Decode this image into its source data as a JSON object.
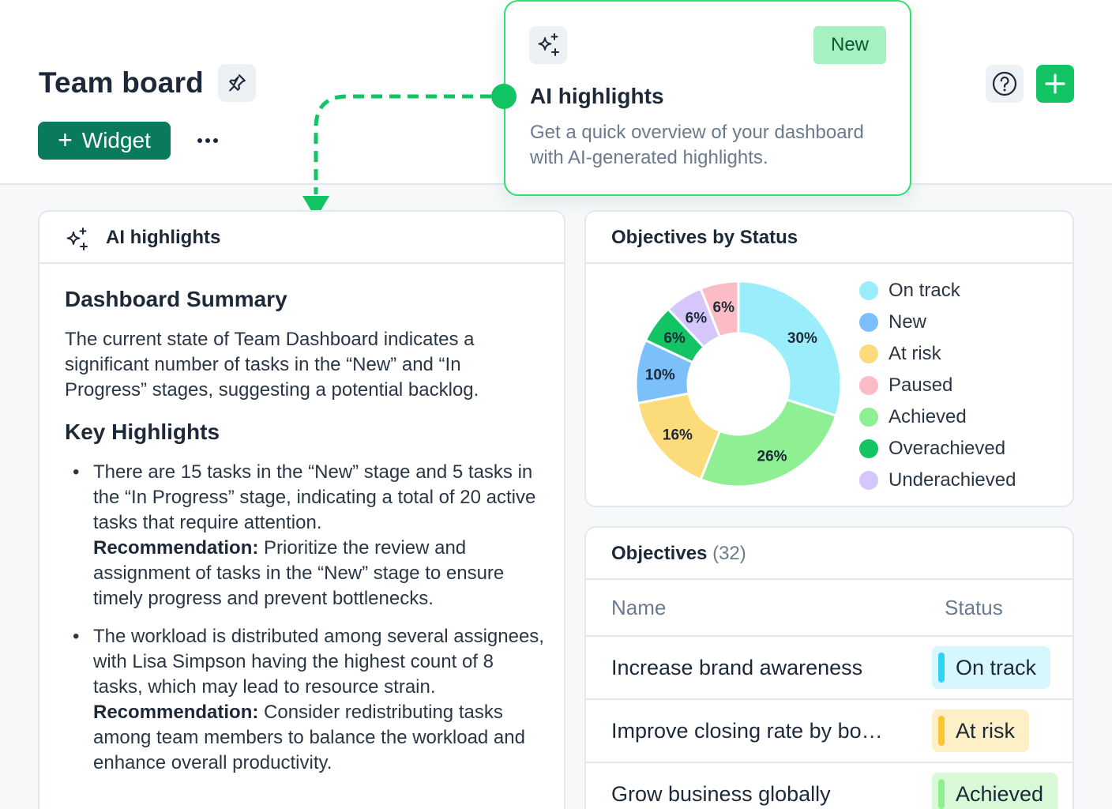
{
  "header": {
    "title": "Team board",
    "widget_label": "Widget"
  },
  "popover": {
    "badge": "New",
    "title": "AI highlights",
    "description": "Get a quick overview of your dashboard with AI-generated highlights."
  },
  "ai_card": {
    "title": "AI highlights",
    "summary_heading": "Dashboard Summary",
    "summary_text": "The current state of Team Dashboard indicates a significant number of tasks in the “New” and “In Progress” stages, suggesting a potential backlog.",
    "key_heading": "Key Highlights",
    "bullets": [
      {
        "text": "There are 15 tasks in the “New” stage and 5 tasks in the “In Progress” stage, indicating a total of 20 active tasks that require attention.",
        "rec_label": "Recommendation:",
        "rec_text": "Prioritize the review and assignment of tasks in the “New” stage to ensure timely progress and prevent bottlenecks."
      },
      {
        "text": "The workload is distributed among several assignees, with Lisa Simpson having the highest count of 8 tasks, which may lead to resource strain.",
        "rec_label": "Recommendation:",
        "rec_text": "Consider redistributing tasks among team members to balance the workload and enhance overall productivity."
      }
    ]
  },
  "status_card": {
    "title": "Objectives by Status"
  },
  "chart_data": {
    "type": "pie",
    "variant": "donut",
    "title": "Objectives by Status",
    "legend_position": "right",
    "slices": [
      {
        "label": "On track",
        "value": 30,
        "color": "#9aeefb"
      },
      {
        "label": "Achieved",
        "value": 26,
        "color": "#8ef093"
      },
      {
        "label": "At risk",
        "value": 16,
        "color": "#fcdc7a"
      },
      {
        "label": "New",
        "value": 10,
        "color": "#7cc0fb"
      },
      {
        "label": "Overachieved",
        "value": 6,
        "color": "#12c463"
      },
      {
        "label": "Underachieved",
        "value": 6,
        "color": "#d5c7fb"
      },
      {
        "label": "Paused",
        "value": 6,
        "color": "#fbbcc6"
      }
    ],
    "legend": [
      {
        "label": "On track",
        "color": "#9aeefb"
      },
      {
        "label": "New",
        "color": "#7cc0fb"
      },
      {
        "label": "At risk",
        "color": "#fcdc7a"
      },
      {
        "label": "Paused",
        "color": "#fbbcc6"
      },
      {
        "label": "Achieved",
        "color": "#8ef093"
      },
      {
        "label": "Overachieved",
        "color": "#12c463"
      },
      {
        "label": "Underachieved",
        "color": "#d5c7fb"
      }
    ]
  },
  "objectives": {
    "title": "Objectives",
    "count": "(32)",
    "columns": [
      "Name",
      "Status"
    ],
    "rows": [
      {
        "name": "Increase brand awareness",
        "status": "On track",
        "bg": "#d6f7fd",
        "bar": "#2fd3f2"
      },
      {
        "name": "Improve closing rate by bo…",
        "status": "At risk",
        "bg": "#fdefc6",
        "bar": "#f7c531"
      },
      {
        "name": "Grow business globally",
        "status": "Achieved",
        "bg": "#d8f8d6",
        "bar": "#8ef093"
      }
    ]
  },
  "colors": {
    "accent_green": "#12c463",
    "widget_button": "#0a7a5c",
    "popover_border": "#2ee06e"
  }
}
